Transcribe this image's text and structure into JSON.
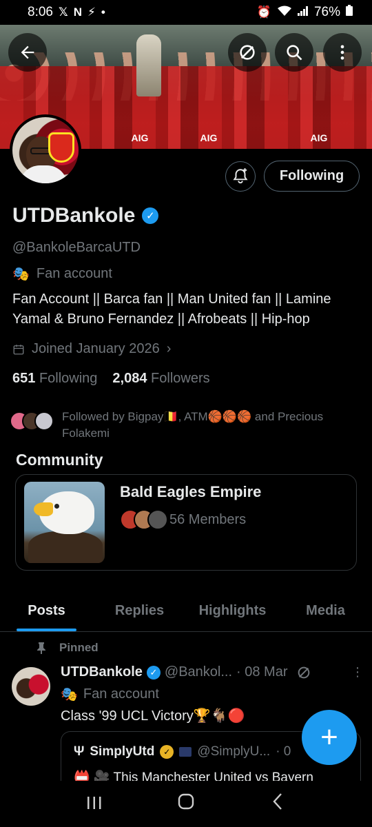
{
  "status_bar": {
    "time": "8:06",
    "battery": "76%"
  },
  "profile": {
    "name": "UTDBankole",
    "handle": "@BankoleBarcaUTD",
    "category": "Fan account",
    "bio": "Fan Account || Barca fan || Man United fan || Lamine Yamal & Bruno Fernandez || Afrobeats || Hip-hop",
    "joined": "Joined January 2026",
    "following_count": "651",
    "following_label": "Following",
    "followers_count": "2,084",
    "followers_label": "Followers",
    "follow_button": "Following",
    "followed_by": "Followed by Bigpay🇧🇪, ATM🏀🏀🏀 and Precious Folakemi",
    "banner_sponsor": "AIG"
  },
  "community": {
    "title": "Community",
    "name": "Bald Eagles Empire",
    "members": "56 Members"
  },
  "tabs": [
    {
      "label": "Posts",
      "active": true
    },
    {
      "label": "Replies",
      "active": false
    },
    {
      "label": "Highlights",
      "active": false
    },
    {
      "label": "Media",
      "active": false
    }
  ],
  "post": {
    "pinned_label": "Pinned",
    "author": "UTDBankole",
    "handle": "@Bankol...",
    "date": "· 08 Mar",
    "category": "Fan account",
    "text": "Class '99 UCL Victory🏆🐐🔴",
    "quote": {
      "author": "SimplyUtd",
      "handle": "@SimplyU...",
      "date": "· 0",
      "text": "📛 🎥 This Manchester United vs Bayern"
    }
  },
  "colors": {
    "accent": "#1d9bf0",
    "background": "#000000",
    "muted": "#71767b",
    "border": "#2f3336"
  }
}
